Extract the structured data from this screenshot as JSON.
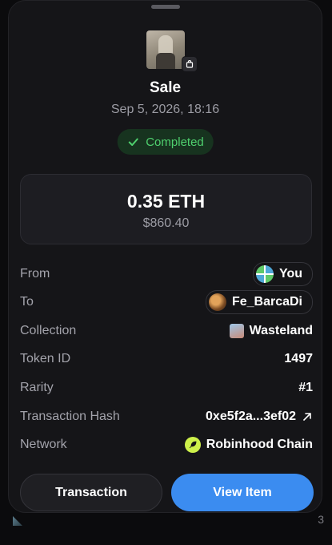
{
  "header": {
    "title": "Sale",
    "datetime": "Sep 5, 2026, 18:16",
    "status": "Completed"
  },
  "price": {
    "amount": "0.35 ETH",
    "usd": "$860.40"
  },
  "details": {
    "from": {
      "label": "From",
      "value": "You"
    },
    "to": {
      "label": "To",
      "value": "Fe_BarcaDi"
    },
    "collection": {
      "label": "Collection",
      "value": "Wasteland"
    },
    "token_id": {
      "label": "Token ID",
      "value": "1497"
    },
    "rarity": {
      "label": "Rarity",
      "value": "#1"
    },
    "tx_hash": {
      "label": "Transaction Hash",
      "value": "0xe5f2a...3ef02"
    },
    "network": {
      "label": "Network",
      "value": "Robinhood Chain"
    }
  },
  "actions": {
    "transaction_label": "Transaction",
    "view_item_label": "View Item"
  },
  "background": {
    "corner_text": "3"
  },
  "colors": {
    "status_green": "#4fd06e",
    "rarity_orange": "#f0883a",
    "primary_blue": "#3b8cf0",
    "chain_lime": "#cdf04a"
  },
  "icons": {
    "status": "check-icon",
    "tx_hash": "arrow-up-right-icon",
    "thumb_badge": "bag-icon",
    "network": "feather-icon"
  }
}
